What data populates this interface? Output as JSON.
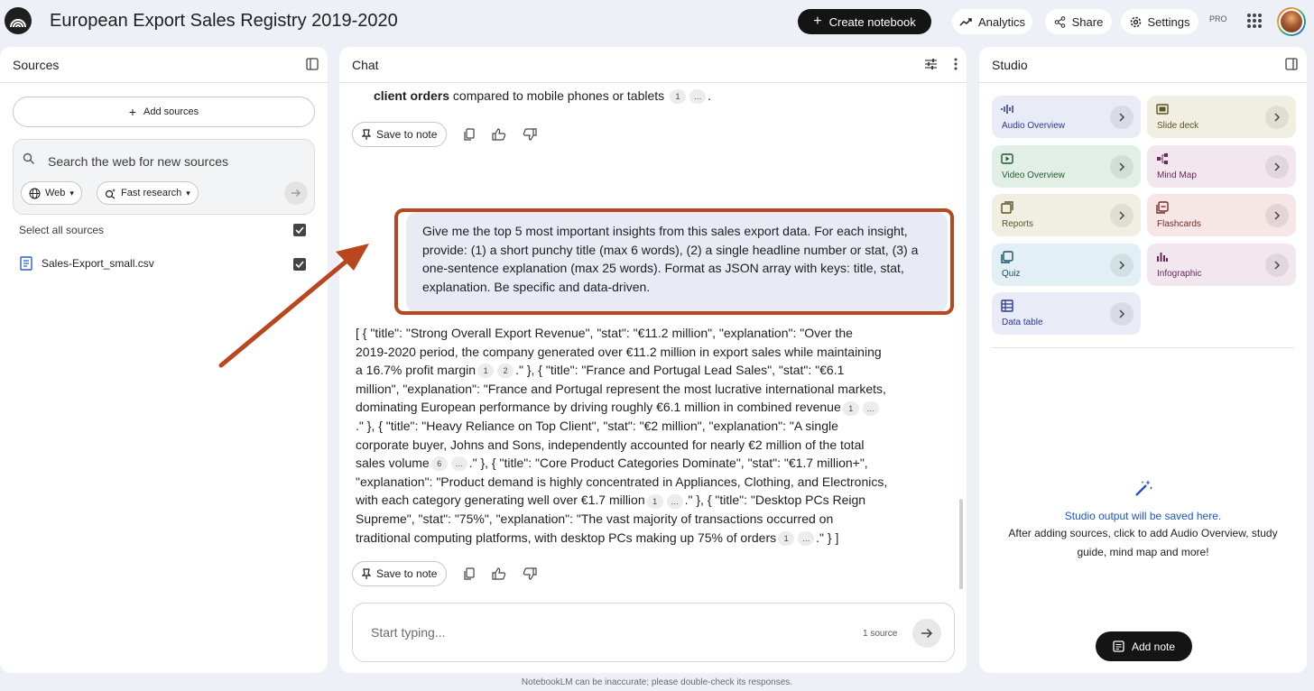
{
  "app": {
    "title": "European Export Sales Registry 2019-2020",
    "create_label": "Create notebook",
    "analytics_label": "Analytics",
    "share_label": "Share",
    "settings_label": "Settings",
    "pro_badge": "PRO"
  },
  "sources": {
    "title": "Sources",
    "add_label": "Add sources",
    "search_placeholder": "Search the web for new sources",
    "web_label": "Web",
    "research_label": "Fast research",
    "select_all": "Select all sources",
    "files": [
      "Sales-Export_small.csv"
    ]
  },
  "chat": {
    "title": "Chat",
    "prev_bold": "client orders",
    "prev_text": "compared to mobile phones or tablets",
    "prev_cite_1": "1",
    "prev_cite_2": "…",
    "prev_end": ".",
    "save_label": "Save to note",
    "user_message": "Give me the top 5 most important insights from this sales export data. For each insight, provide: (1) a short punchy title (max 6 words), (2) a single headline number or stat, (3) a one-sentence explanation (max 25 words). Format as JSON array with keys: title, stat, explanation. Be specific and data-driven.",
    "response": [
      {
        "text": "[ { \"title\": \"Strong Overall Export Revenue\", \"stat\": \"€11.2 million\", \"explanation\": \"Over the 2019-2020 period, the company generated over €11.2 million in export sales while maintaining a 16.7% profit margin",
        "cites": [
          "1",
          "2"
        ]
      },
      {
        "text": ".\" }, { \"title\": \"France and Portugal Lead Sales\", \"stat\": \"€6.1 million\", \"explanation\": \"France and Portugal represent the most lucrative international markets, dominating European performance by driving roughly €6.1 million in combined revenue",
        "cites": [
          "1",
          "…"
        ]
      },
      {
        "text": ".\" }, { \"title\": \"Heavy Reliance on Top Client\", \"stat\": \"€2 million\", \"explanation\": \"A single corporate buyer, Johns and Sons, independently accounted for nearly €2 million of the total sales volume",
        "cites": [
          "6",
          "…"
        ]
      },
      {
        "text": ".\" }, { \"title\": \"Core Product Categories Dominate\", \"stat\": \"€1.7 million+\", \"explanation\": \"Product demand is highly concentrated in Appliances, Clothing, and Electronics, with each category generating well over €1.7 million",
        "cites": [
          "1",
          "…"
        ]
      },
      {
        "text": ".\" }, { \"title\": \"Desktop PCs Reign Supreme\", \"stat\": \"75%\", \"explanation\": \"The vast majority of transactions occurred on traditional computing platforms, with desktop PCs making up 75% of orders",
        "cites": [
          "1",
          "…"
        ]
      },
      {
        "text": ".\" } ]",
        "cites": []
      }
    ],
    "input_placeholder": "Start typing...",
    "source_count": "1 source"
  },
  "studio": {
    "title": "Studio",
    "tiles": [
      {
        "label": "Audio Overview",
        "bg": "#e9ebf6",
        "color": "#2a3a8c",
        "icon": "audio-icon"
      },
      {
        "label": "Slide deck",
        "bg": "#f0efe2",
        "color": "#5a5424",
        "icon": "slides-icon"
      },
      {
        "label": "Video Overview",
        "bg": "#e2efe6",
        "color": "#1f5b33",
        "icon": "video-icon"
      },
      {
        "label": "Mind Map",
        "bg": "#f2e7ef",
        "color": "#6b2a5b",
        "icon": "mindmap-icon"
      },
      {
        "label": "Reports",
        "bg": "#f0efe2",
        "color": "#5a5424",
        "icon": "reports-icon"
      },
      {
        "label": "Flashcards",
        "bg": "#f6e6e6",
        "color": "#7a2a2a",
        "icon": "flashcards-icon"
      },
      {
        "label": "Quiz",
        "bg": "#e2f0f5",
        "color": "#1b4f63",
        "icon": "quiz-icon"
      },
      {
        "label": "Infographic",
        "bg": "#f2e7ef",
        "color": "#6b2a5b",
        "icon": "infographic-icon"
      },
      {
        "label": "Data table",
        "bg": "#e9ebf6",
        "color": "#2a3a8c",
        "icon": "table-icon"
      }
    ],
    "empty_title": "Studio output will be saved here.",
    "empty_desc": "After adding sources, click to add Audio Overview, study guide, mind map and more!",
    "add_note_label": "Add note"
  },
  "footer": "NotebookLM can be inaccurate; please double-check its responses.",
  "colors": {
    "highlight": "#b8471f",
    "accent_link": "#1a56c4"
  }
}
